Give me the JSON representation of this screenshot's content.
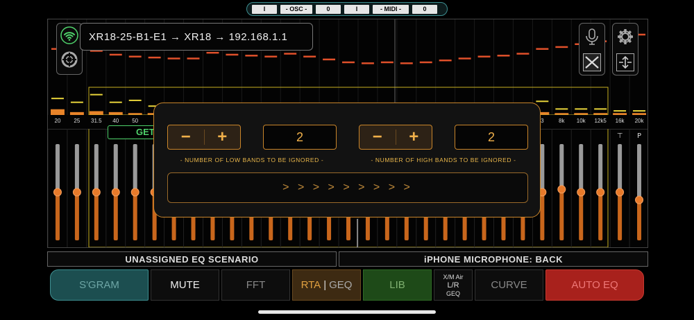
{
  "status_bar": {
    "cells": [
      "I",
      "- OSC -",
      "0",
      "I",
      "- MIDI -",
      "0"
    ]
  },
  "connection": {
    "label": "XR18-25-B1-E1 → XR18 → 192.168.1.1"
  },
  "icons": {
    "wifi": "wifi-icon",
    "percent": "percent-icon",
    "lifebuoy": "lifebuoy-icon",
    "microphone": "microphone-icon",
    "gear": "gear-icon",
    "bowtie": "bowtie-icon",
    "expand": "expand-vertical-icon"
  },
  "colors": {
    "accent_orange": "#e8842a",
    "modal_border": "#c9852a",
    "caption_yellow": "#e9b64a",
    "green": "#4fd36b",
    "teal": "#3d8f91",
    "red": "#a8211c"
  },
  "rta": {
    "freq_labels": [
      "20",
      "25",
      "31.5",
      "40",
      "50",
      "",
      "",
      "",
      "",
      "",
      "",
      "",
      "",
      "",
      "",
      "",
      "",
      "",
      "",
      "",
      "",
      "",
      "",
      "",
      "",
      "3",
      "8k",
      "10k",
      "12k5",
      "16k",
      "20k"
    ],
    "peak_levels": [
      0.3,
      0.28,
      0.32,
      0.36,
      0.38,
      0.39,
      0.4,
      0.4,
      0.34,
      0.36,
      0.37,
      0.38,
      0.35,
      0.38,
      0.41,
      0.44,
      0.45,
      0.44,
      0.45,
      0.44,
      0.42,
      0.4,
      0.38,
      0.37,
      0.35,
      0.3,
      0.28,
      0.25,
      0.22,
      0.18,
      0.15
    ],
    "avg_levels": [
      0.82,
      0.86,
      0.78,
      0.86,
      0.84,
      0.9,
      0.9,
      0.9,
      0.9,
      0.9,
      0.9,
      0.9,
      0.9,
      0.9,
      0.9,
      0.9,
      0.9,
      0.9,
      0.9,
      0.9,
      0.9,
      0.9,
      0.9,
      0.9,
      0.9,
      0.85,
      0.93,
      0.93,
      0.93,
      0.95,
      0.95
    ],
    "bar_levels": [
      0.06,
      0.03,
      0.04,
      0.03,
      0.02,
      0.02,
      0.02,
      0.02,
      0.02,
      0.02,
      0.02,
      0.02,
      0.02,
      0.02,
      0.02,
      0.02,
      0.02,
      0.02,
      0.02,
      0.02,
      0.02,
      0.02,
      0.02,
      0.02,
      0.02,
      0.03,
      0.02,
      0.02,
      0.02,
      0.02,
      0.02
    ]
  },
  "faders": {
    "count": 31,
    "levels": [
      0.5,
      0.5,
      0.5,
      0.5,
      0.5,
      0.5,
      0.5,
      0.5,
      0.5,
      0.5,
      0.5,
      0.5,
      0.5,
      0.5,
      0.5,
      0.5,
      0.5,
      0.5,
      0.5,
      0.5,
      0.5,
      0.5,
      0.5,
      0.5,
      0.5,
      0.5,
      0.53,
      0.5,
      0.5,
      0.5,
      0.42
    ],
    "top_icons": [
      "lock-icon",
      "pin-icon"
    ]
  },
  "get_button": {
    "label": "GET"
  },
  "modal": {
    "low": {
      "minus": "−",
      "plus": "+",
      "value": "2",
      "caption": "- NUMBER OF LOW BANDS TO BE IGNORED -"
    },
    "high": {
      "minus": "−",
      "plus": "+",
      "value": "2",
      "caption": "- NUMBER OF HIGH BANDS TO BE IGNORED -"
    },
    "go_label": "> > > > > > > > >"
  },
  "info_bar": {
    "left": "UNASSIGNED EQ SCENARIO",
    "right": "iPHONE MICROPHONE: BACK"
  },
  "bottom_buttons": {
    "sgram": "S'GRAM",
    "mute": "MUTE",
    "fft": "FFT",
    "rta": "RTA",
    "geq": "GEQ",
    "lib": "LIB",
    "xm_air": "X/M Air",
    "lr": "L/R",
    "xm_geq": "GEQ",
    "curve": "CURVE",
    "auto_eq": "AUTO EQ"
  }
}
